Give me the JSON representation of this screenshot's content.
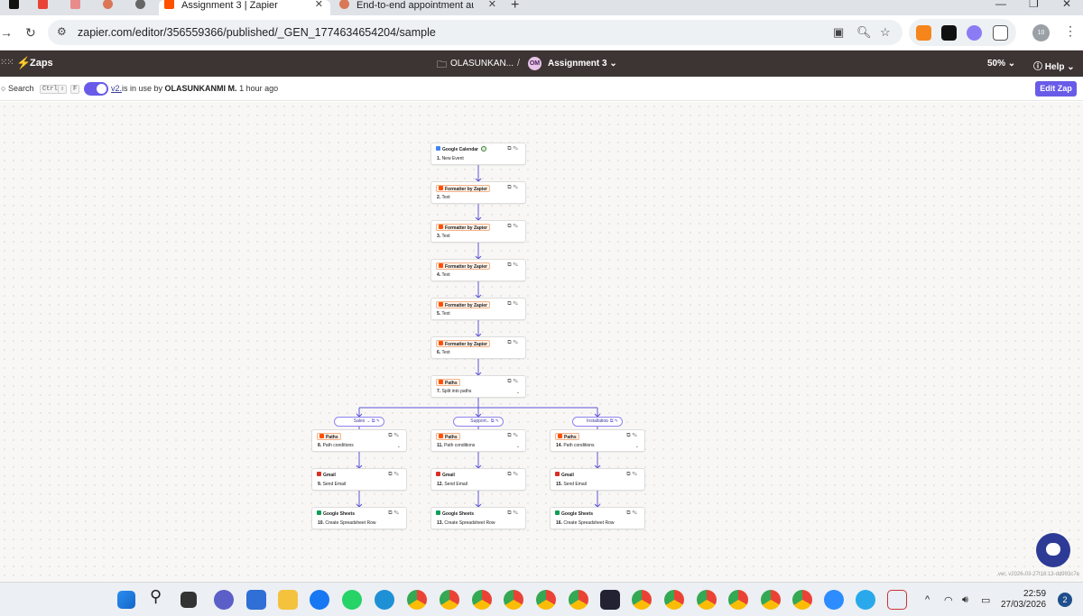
{
  "browser": {
    "tabs": [
      {
        "title": "Assignment 3 | Zapier",
        "active": true
      },
      {
        "title": "End-to-end appointment autom",
        "active": false
      }
    ],
    "new_tab": "+",
    "url": "zapier.com/editor/356559366/published/_GEN_1774634654204/sample",
    "profile_badge": "10"
  },
  "zapier_header": {
    "app_label": "Zaps",
    "folder": "OLASUNKAN...",
    "separator": "/",
    "avatar_initials": "OM",
    "zap_name": "Assignment 3",
    "zoom": "50%",
    "help": "Help"
  },
  "toolbar": {
    "search_label": "Search",
    "shortcut_keys": [
      "Ctrl",
      "⇧",
      "F"
    ],
    "version_link": "v2.",
    "in_use_text": "is in use by",
    "in_use_user": "OLASUNKANMI M.",
    "in_use_time": "1 hour ago",
    "edit_button": "Edit Zap"
  },
  "workflow": {
    "main_steps": [
      {
        "app": "Google Calendar",
        "number": "1.",
        "title": "New Event",
        "icon_color": "#4285f4",
        "badge": false,
        "checked": true
      },
      {
        "app": "Formatter by Zapier",
        "number": "2.",
        "title": "Text",
        "icon_color": "#ff4f00",
        "badge": true
      },
      {
        "app": "Formatter by Zapier",
        "number": "3.",
        "title": "Text",
        "icon_color": "#ff4f00",
        "badge": true
      },
      {
        "app": "Formatter by Zapier",
        "number": "4.",
        "title": "Text",
        "icon_color": "#ff4f00",
        "badge": true
      },
      {
        "app": "Formatter by Zapier",
        "number": "5.",
        "title": "Text",
        "icon_color": "#ff4f00",
        "badge": true
      },
      {
        "app": "Formatter by Zapier",
        "number": "6.",
        "title": "Text",
        "icon_color": "#ff4f00",
        "badge": true
      },
      {
        "app": "Paths",
        "number": "7.",
        "title": "Split into paths",
        "icon_color": "#ff4f00",
        "badge": true,
        "chevron": true
      }
    ],
    "branches": [
      {
        "label": "Sales",
        "steps": [
          {
            "app": "Paths",
            "number": "8.",
            "title": "Path conditions",
            "icon_color": "#ff4f00",
            "badge": true,
            "chevron": true
          },
          {
            "app": "Gmail",
            "number": "9.",
            "title": "Send Email",
            "icon_color": "#d93025",
            "badge": false
          },
          {
            "app": "Google Sheets",
            "number": "10.",
            "title": "Create Spreadsheet Row",
            "icon_color": "#0f9d58",
            "badge": false
          }
        ]
      },
      {
        "label": "Support",
        "steps": [
          {
            "app": "Paths",
            "number": "11.",
            "title": "Path conditions",
            "icon_color": "#ff4f00",
            "badge": true,
            "chevron": true
          },
          {
            "app": "Gmail",
            "number": "12.",
            "title": "Send Email",
            "icon_color": "#d93025",
            "badge": false
          },
          {
            "app": "Google Sheets",
            "number": "13.",
            "title": "Create Spreadsheet Row",
            "icon_color": "#0f9d58",
            "badge": false
          }
        ]
      },
      {
        "label": "Installation",
        "steps": [
          {
            "app": "Paths",
            "number": "14.",
            "title": "Path conditions",
            "icon_color": "#ff4f00",
            "badge": true,
            "chevron": true
          },
          {
            "app": "Gmail",
            "number": "15.",
            "title": "Send Email",
            "icon_color": "#d93025",
            "badge": false
          },
          {
            "app": "Google Sheets",
            "number": "16.",
            "title": "Create Spreadsheet Row",
            "icon_color": "#0f9d58",
            "badge": false
          }
        ]
      }
    ],
    "version_string": "ver. v2026-03-27t16:13-dd993c7e"
  },
  "colors": {
    "zapier_orange": "#ff4f00",
    "accent_purple": "#695be8",
    "header_dark": "#3d3533",
    "connector": "#5b54d6"
  },
  "taskbar": {
    "time": "22:59",
    "date": "27/03/2026",
    "notification_count": "2"
  }
}
